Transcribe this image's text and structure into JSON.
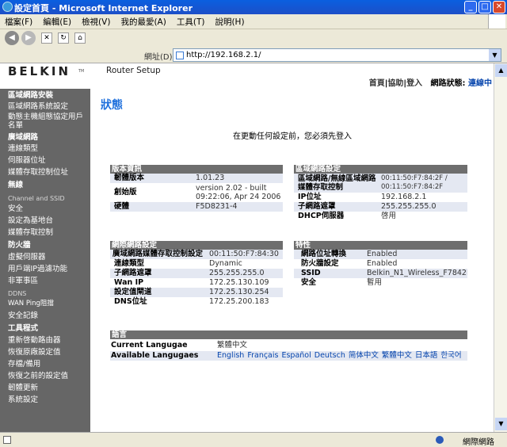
{
  "window": {
    "title": "設定首頁 - Microsoft Internet Explorer"
  },
  "menu": [
    "檔案(F)",
    "編輯(E)",
    "檢視(V)",
    "我的最愛(A)",
    "工具(T)",
    "說明(H)"
  ],
  "address": {
    "label": "網址(D)",
    "url": "http://192.168.2.1/"
  },
  "header": {
    "logo": "BELKIN",
    "logo_tm": "TM",
    "app_title": "Router Setup",
    "links": {
      "home": "首頁",
      "help": "協助",
      "login": "登入",
      "status_label": "網路狀態:",
      "status_value": "連線中"
    }
  },
  "sidebar": {
    "s1_head": "區域網路安裝",
    "s1_items": [
      "區域網路系統設定",
      "動態主機組態協定用戶名單"
    ],
    "s2_head": "廣域網路",
    "s2_items": [
      "連線類型",
      "伺服器位址",
      "媒體存取控制位址"
    ],
    "s3_head": "無線",
    "s3_items": [
      "Channel and SSID",
      "安全",
      "設定為基地台",
      "媒體存取控制"
    ],
    "s4_head": "防火牆",
    "s4_items": [
      "虛擬伺服器",
      "用戶端IP過濾功能",
      "非軍事區",
      "DDNS",
      "WAN Ping阻擋",
      "安全記錄"
    ],
    "s5_head": "工具程式",
    "s5_items": [
      "重新啓動路由器",
      "恢復原廠設定值",
      "存檔/備用",
      "恢復之前的設定值",
      "韌體更新",
      "系統設定"
    ]
  },
  "main": {
    "title": "狀態",
    "login_msg": "在更動任何設定前，您必須先登入",
    "version": {
      "head": "版本資訊",
      "rows": [
        {
          "label": "韌體版本",
          "value": "1.01.23"
        },
        {
          "label": "創始版",
          "value": "version 2.02 - built 09:22:06, Apr 24 2006"
        },
        {
          "label": "硬體",
          "value": "F5D8231-4"
        }
      ]
    },
    "lan": {
      "head": "區域網路設定",
      "rows": [
        {
          "label": "區域網路/無線區域網路 媒體存取控制",
          "value": "00:11:50:F7:84:2F / 00:11:50:F7:84:2F"
        },
        {
          "label": "IP位址",
          "value": "192.168.2.1"
        },
        {
          "label": "子網路遮罩",
          "value": "255.255.255.0"
        },
        {
          "label": "DHCP伺服器",
          "value": "啓用"
        }
      ]
    },
    "wan": {
      "head": "網際網路設定",
      "rows": [
        {
          "label": "廣域網路媒體存取控制設定",
          "value": "00:11:50:F7:84:30"
        },
        {
          "label": "連線類型",
          "value": "Dynamic"
        },
        {
          "label": "子網路遮罩",
          "value": "255.255.255.0"
        },
        {
          "label": "Wan IP",
          "value": "172.25.130.109"
        },
        {
          "label": "設定值閘道",
          "value": "172.25.130.254"
        },
        {
          "label": "DNS位址",
          "value": "172.25.200.183"
        }
      ]
    },
    "features": {
      "head": "特性",
      "rows": [
        {
          "label": "網路位址轉換",
          "value": "Enabled"
        },
        {
          "label": "防火牆設定",
          "value": "Enabled"
        },
        {
          "label": "SSID",
          "value": "Belkin_N1_Wireless_F7842F"
        },
        {
          "label": "安全",
          "value": "暫用"
        }
      ]
    },
    "language": {
      "head": "語言",
      "current_label": "Current Langugae",
      "current_value": "繁體中文",
      "available_label": "Available Langugaes",
      "options": [
        "English",
        "Français",
        "Español",
        "Deutsch",
        "简体中文",
        "繁體中文",
        "日本語",
        "한국어"
      ]
    }
  },
  "status": {
    "zone": "網際網路"
  }
}
